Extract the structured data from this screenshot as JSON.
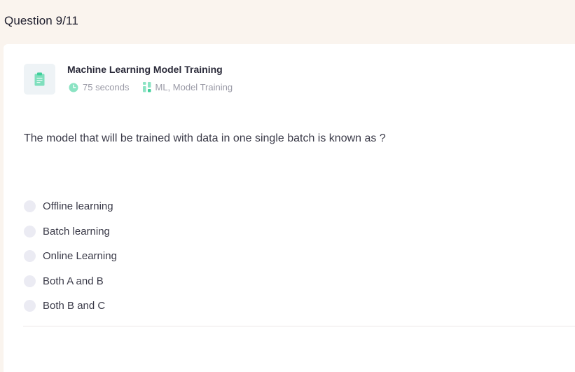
{
  "header": {
    "question_counter": "Question 9/11"
  },
  "quiz": {
    "title": "Machine Learning Model Training",
    "duration": "75 seconds",
    "tags": "ML, Model Training",
    "icon": "clipboard-icon"
  },
  "question": {
    "text": "The model that will be trained with data in one single batch is known as ?",
    "options": [
      {
        "label": "Offline learning",
        "selected": false
      },
      {
        "label": "Batch learning",
        "selected": false
      },
      {
        "label": "Online Learning",
        "selected": false
      },
      {
        "label": "Both A and B",
        "selected": false
      },
      {
        "label": "Both B and C",
        "selected": false
      }
    ]
  },
  "colors": {
    "page_background": "#faf4ee",
    "card_background": "#ffffff",
    "accent_green": "#3fcf9a",
    "radio_fill": "#ebebf3"
  }
}
